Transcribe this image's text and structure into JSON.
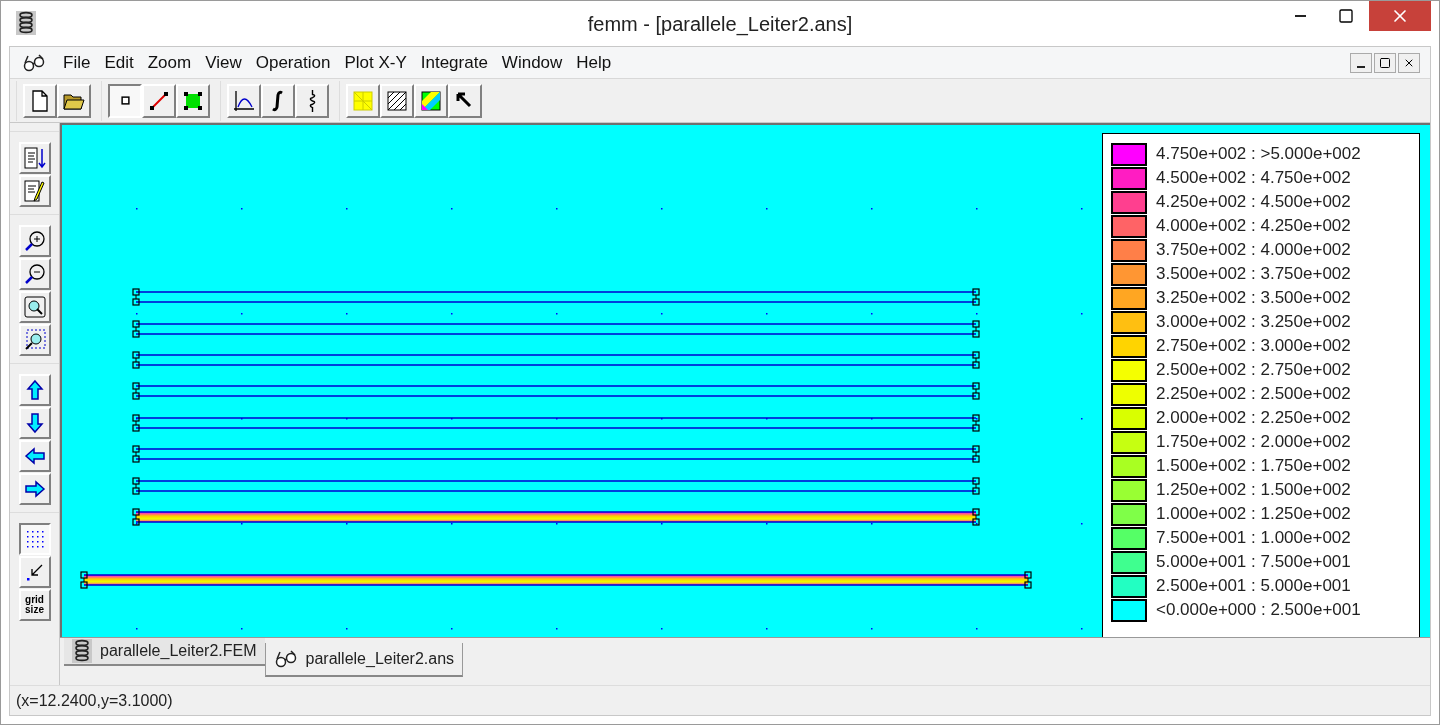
{
  "window": {
    "title": "femm - [parallele_Leiter2.ans]"
  },
  "menu": [
    "File",
    "Edit",
    "Zoom",
    "View",
    "Operation",
    "Plot X-Y",
    "Integrate",
    "Window",
    "Help"
  ],
  "toolbar": [
    {
      "kind": "new",
      "pressed": false
    },
    {
      "kind": "open",
      "pressed": false
    },
    {
      "kind": "point",
      "pressed": true
    },
    {
      "kind": "line",
      "pressed": false
    },
    {
      "kind": "area",
      "pressed": false
    },
    {
      "kind": "plot",
      "pressed": false
    },
    {
      "kind": "integral",
      "pressed": false
    },
    {
      "kind": "circuit",
      "pressed": false
    },
    {
      "kind": "mesh",
      "pressed": false
    },
    {
      "kind": "hatch",
      "pressed": false
    },
    {
      "kind": "density",
      "pressed": false
    },
    {
      "kind": "pointer",
      "pressed": false
    }
  ],
  "side_toolbar": [
    {
      "kind": "list",
      "pressed": false
    },
    {
      "kind": "edit",
      "pressed": false
    },
    {
      "kind": "zoom-in",
      "pressed": false
    },
    {
      "kind": "zoom-out",
      "pressed": false
    },
    {
      "kind": "zoom-fit",
      "pressed": false
    },
    {
      "kind": "zoom-window",
      "pressed": false
    },
    {
      "kind": "up",
      "pressed": false
    },
    {
      "kind": "down",
      "pressed": false
    },
    {
      "kind": "left",
      "pressed": false
    },
    {
      "kind": "right",
      "pressed": false
    },
    {
      "kind": "grid",
      "pressed": true
    },
    {
      "kind": "snap",
      "pressed": false
    },
    {
      "kind": "grid-size",
      "label": "grid size",
      "pressed": false
    }
  ],
  "legend": [
    {
      "range": "4.750e+002 : >5.000e+002",
      "color": "#ff00ff"
    },
    {
      "range": "4.500e+002 : 4.750e+002",
      "color": "#ff1dc2"
    },
    {
      "range": "4.250e+002 : 4.500e+002",
      "color": "#ff3f8f"
    },
    {
      "range": "4.000e+002 : 4.250e+002",
      "color": "#ff6366"
    },
    {
      "range": "3.750e+002 : 4.000e+002",
      "color": "#ff7f48"
    },
    {
      "range": "3.500e+002 : 3.750e+002",
      "color": "#ff9633"
    },
    {
      "range": "3.250e+002 : 3.500e+002",
      "color": "#ffa622"
    },
    {
      "range": "3.000e+002 : 3.250e+002",
      "color": "#ffbf11"
    },
    {
      "range": "2.750e+002 : 3.000e+002",
      "color": "#ffd400"
    },
    {
      "range": "2.500e+002 : 2.750e+002",
      "color": "#f5ff00"
    },
    {
      "range": "2.250e+002 : 2.500e+002",
      "color": "#eeff00"
    },
    {
      "range": "2.000e+002 : 2.250e+002",
      "color": "#d9ff00"
    },
    {
      "range": "1.750e+002 : 2.000e+002",
      "color": "#c6ff11"
    },
    {
      "range": "1.500e+002 : 1.750e+002",
      "color": "#a9ff22"
    },
    {
      "range": "1.250e+002 : 1.500e+002",
      "color": "#99ff33"
    },
    {
      "range": "1.000e+002 : 1.250e+002",
      "color": "#7fff48"
    },
    {
      "range": "7.500e+001 : 1.000e+002",
      "color": "#55ff66"
    },
    {
      "range": "5.000e+001 : 7.500e+001",
      "color": "#3fff8f"
    },
    {
      "range": "2.500e+001 : 5.000e+001",
      "color": "#22ffc2"
    },
    {
      "range": "<0.000e+000 : 2.500e+001",
      "color": "#00ffff"
    }
  ],
  "document_tabs": [
    {
      "label": "parallele_Leiter2.FEM",
      "kind": "fem",
      "selected": false
    },
    {
      "label": "parallele_Leiter2.ans",
      "kind": "ans",
      "selected": true
    }
  ],
  "status_bar": "(x=12.2400,y=3.1000)"
}
